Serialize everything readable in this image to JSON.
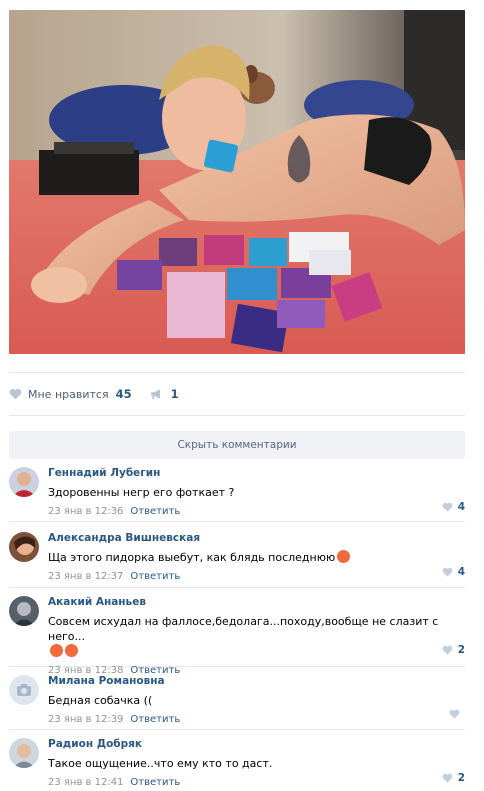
{
  "post": {
    "likes_label": "Мне нравится",
    "likes_count": "45",
    "shares_count": "1"
  },
  "comments_toggle": "Скрыть комментарии",
  "comments": [
    {
      "author": "Геннадий Лубегин",
      "text": "Здоровенны негр его фоткает ?",
      "date": "23 янв в 12:36",
      "reply": "Ответить",
      "likes": "4"
    },
    {
      "author": "Александра Вишневская",
      "text": "Ща этого пидорка выебут, как блядь последнюю",
      "date": "23 янв в 12:37",
      "reply": "Ответить",
      "likes": "4"
    },
    {
      "author": "Акакий Ананьев",
      "text": "Совсем исхудал на фаллосе,бедолага...походу,вообще не слазит с него...",
      "date": "23 янв в 12:38",
      "reply": "Ответить",
      "likes": "2"
    },
    {
      "author": "Милана Романовна",
      "text": "Бедная собачка ((",
      "date": "23 янв в 12:39",
      "reply": "Ответить",
      "likes": ""
    },
    {
      "author": "Радион Добряк",
      "text": "Такое ощущение..что ему кто то даст.",
      "date": "23 янв в 12:41",
      "reply": "Ответить",
      "likes": "2"
    }
  ]
}
